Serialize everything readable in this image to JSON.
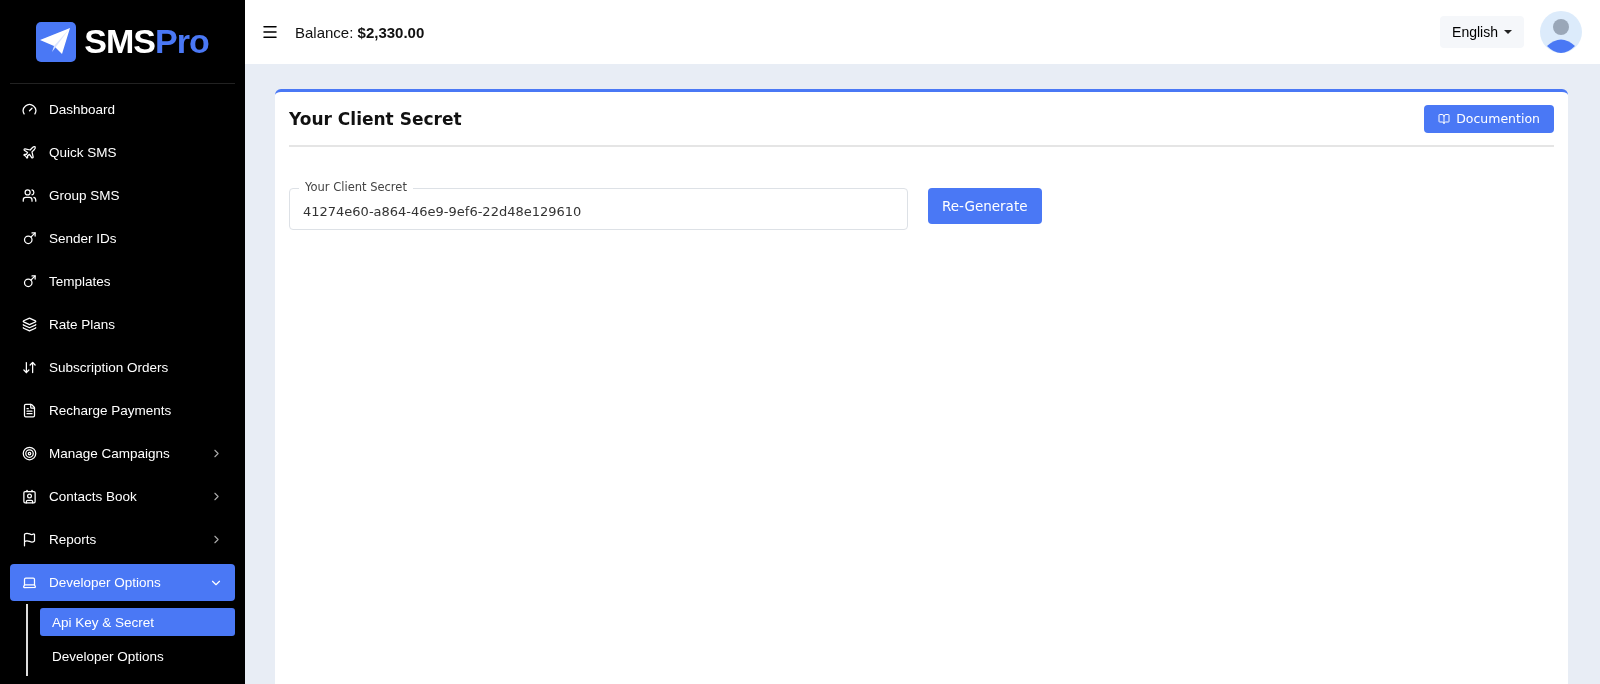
{
  "brand": {
    "first": "SMS",
    "second": "Pro"
  },
  "sidebar": {
    "items": [
      {
        "kind": "link",
        "label": "Dashboard",
        "selected": false
      },
      {
        "kind": "link",
        "label": "Quick SMS",
        "selected": false
      },
      {
        "kind": "link",
        "label": "Group SMS",
        "selected": false
      },
      {
        "kind": "link",
        "label": "Sender IDs",
        "selected": false
      },
      {
        "kind": "link",
        "label": "Templates",
        "selected": false
      },
      {
        "kind": "link",
        "label": "Rate Plans",
        "selected": false
      },
      {
        "kind": "link",
        "label": "Subscription Orders",
        "selected": false
      },
      {
        "kind": "link",
        "label": "Recharge Payments",
        "selected": false
      },
      {
        "kind": "group",
        "label": "Manage Campaigns",
        "expanded": false,
        "selected": false
      },
      {
        "kind": "group",
        "label": "Contacts Book",
        "expanded": false,
        "selected": false
      },
      {
        "kind": "group",
        "label": "Reports",
        "expanded": false,
        "selected": false
      },
      {
        "kind": "group",
        "label": "Developer Options",
        "expanded": true,
        "selected": true,
        "children": [
          {
            "label": "Api Key & Secret",
            "selected": true
          },
          {
            "label": "Developer Options",
            "selected": false
          }
        ]
      }
    ]
  },
  "topbar": {
    "balance_label": "Balance:",
    "balance_value": "$2,330.00",
    "language": "English"
  },
  "card": {
    "title": "Your Client Secret",
    "doc_button": "Documention",
    "field": {
      "label": "Your Client Secret",
      "value": "41274e60-a864-46e9-9ef6-22d48e129610"
    },
    "regenerate_button": "Re-Generate"
  }
}
